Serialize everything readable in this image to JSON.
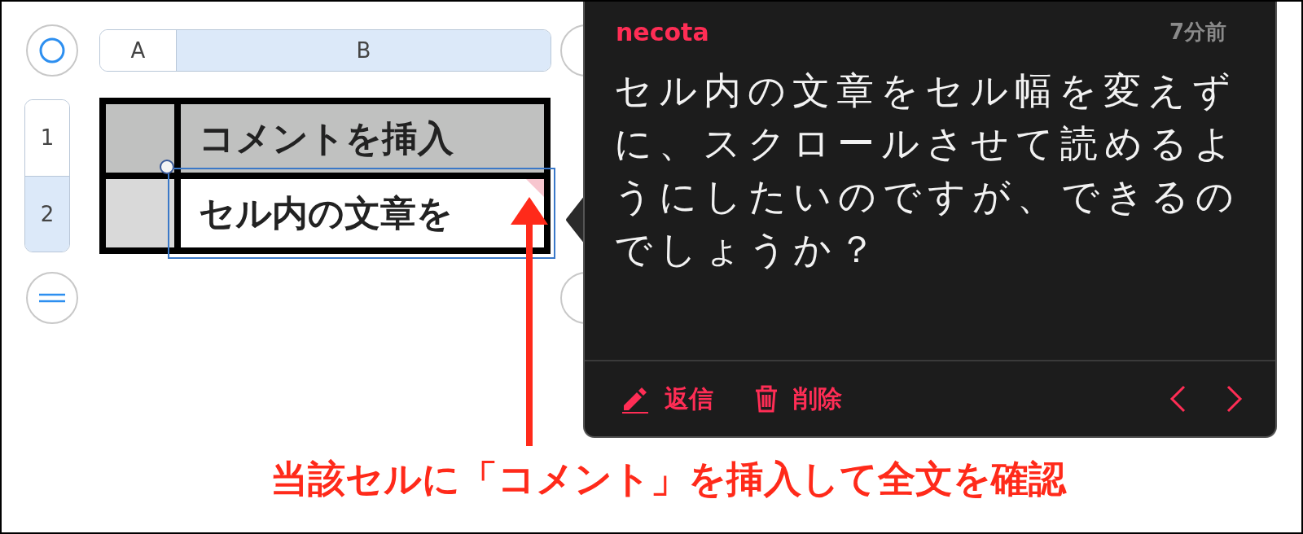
{
  "sheet": {
    "column_headers": [
      {
        "label": "A",
        "selected": false
      },
      {
        "label": "B",
        "selected": true
      }
    ],
    "row_headers": [
      {
        "label": "1",
        "selected": false
      },
      {
        "label": "2",
        "selected": true
      }
    ],
    "rows": [
      {
        "text": "コメントを挿入",
        "kind": "header",
        "selected": false,
        "has_comment": false
      },
      {
        "text": "セル内の文章を",
        "kind": "body",
        "selected": true,
        "has_comment": true
      }
    ]
  },
  "comment": {
    "author": "necota",
    "time": "7分前",
    "text": "セル内の文章をセル幅を変えずに、スクロールさせて読めるようにしたいのですが、できるのでしょうか？",
    "actions": [
      {
        "label": "返信",
        "kind": "reply"
      },
      {
        "label": "削除",
        "kind": "delete"
      }
    ]
  },
  "annotation": {
    "caption": "当該セルに「コメント」を挿入して全文を確認"
  }
}
